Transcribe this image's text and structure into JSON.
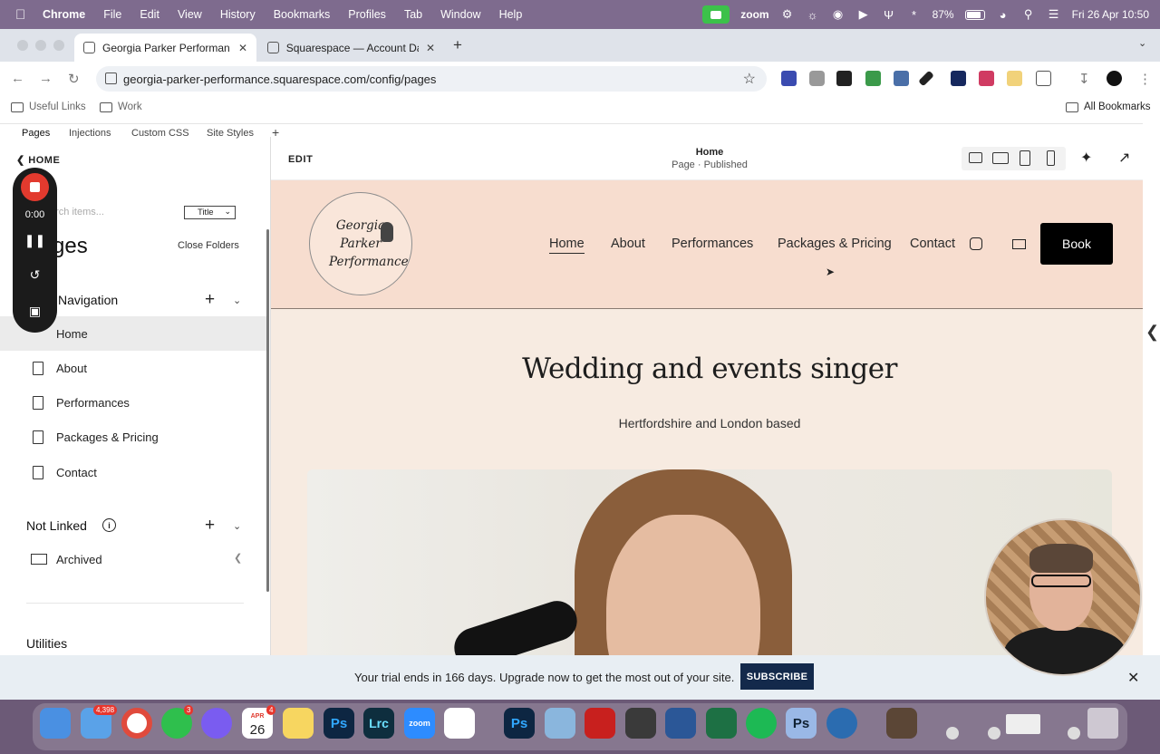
{
  "menubar": {
    "app": "Chrome",
    "items": [
      "File",
      "Edit",
      "View",
      "History",
      "Bookmarks",
      "Profiles",
      "Tab",
      "Window",
      "Help"
    ],
    "zoom_label": "zoom",
    "battery": "87%",
    "datetime": "Fri 26 Apr  10:50"
  },
  "tabs": [
    {
      "title": "Georgia Parker Performance |",
      "active": true
    },
    {
      "title": "Squarespace — Account Dasl",
      "active": false
    }
  ],
  "address": {
    "url": "georgia-parker-performance.squarespace.com/config/pages"
  },
  "bookmarks": {
    "items": [
      "Useful Links",
      "Work"
    ],
    "all": "All Bookmarks"
  },
  "devtabs": [
    "Pages",
    "Injections",
    "Custom CSS",
    "Site Styles"
  ],
  "leftpanel": {
    "back": "HOME",
    "search_placeholder": "arch items...",
    "sort": "Title",
    "title": "ges",
    "close_folders": "Close Folders",
    "main_nav": "Navigation",
    "pages": [
      "Home",
      "About",
      "Performances",
      "Packages & Pricing",
      "Contact"
    ],
    "not_linked": "Not Linked",
    "archived": "Archived",
    "utilities": "Utilities"
  },
  "recorder": {
    "time": "0:00"
  },
  "editor": {
    "edit": "EDIT",
    "page_title": "Home",
    "page_status": "Page · Published"
  },
  "site": {
    "logo_text": "Georgia Parker Performance",
    "nav": [
      "Home",
      "About",
      "Performances",
      "Packages & Pricing",
      "Contact"
    ],
    "book": "Book",
    "hero_title": "Wedding and events singer",
    "hero_sub": "Hertfordshire and London based"
  },
  "trial": {
    "message": "Your trial ends in 166 days. Upgrade now to get the most out of your site.",
    "button": "SUBSCRIBE"
  },
  "dock": {
    "mail_badge": "4,398",
    "whatsapp_badge": "3",
    "cal_month": "APR",
    "cal_day": "26",
    "cal_badge": "4",
    "zoom": "zoom",
    "lrc": "Lrc",
    "ps": "Ps"
  },
  "colors": {
    "menubar": "#7e6b8e",
    "site_bg": "#f7ddcf",
    "subscribe": "#13294b",
    "record": "#e23a2e"
  }
}
